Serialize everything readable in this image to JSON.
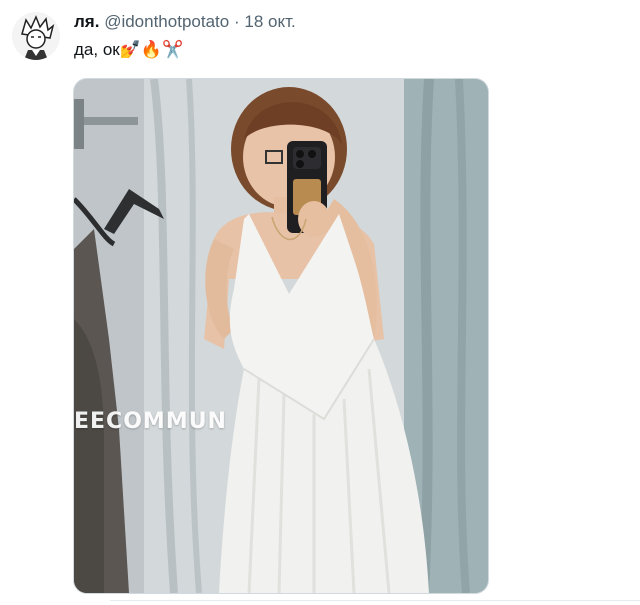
{
  "tweet": {
    "display_name": "ля.",
    "handle": "@idonthotpotato",
    "separator": "·",
    "date": "18 окт.",
    "text": "да, ок",
    "emojis": "💅🔥✂️"
  },
  "media": {
    "watermark": "EECOMMUN"
  },
  "colors": {
    "text_primary": "#0f1419",
    "text_secondary": "#536471",
    "media_border": "#cfd9de"
  }
}
